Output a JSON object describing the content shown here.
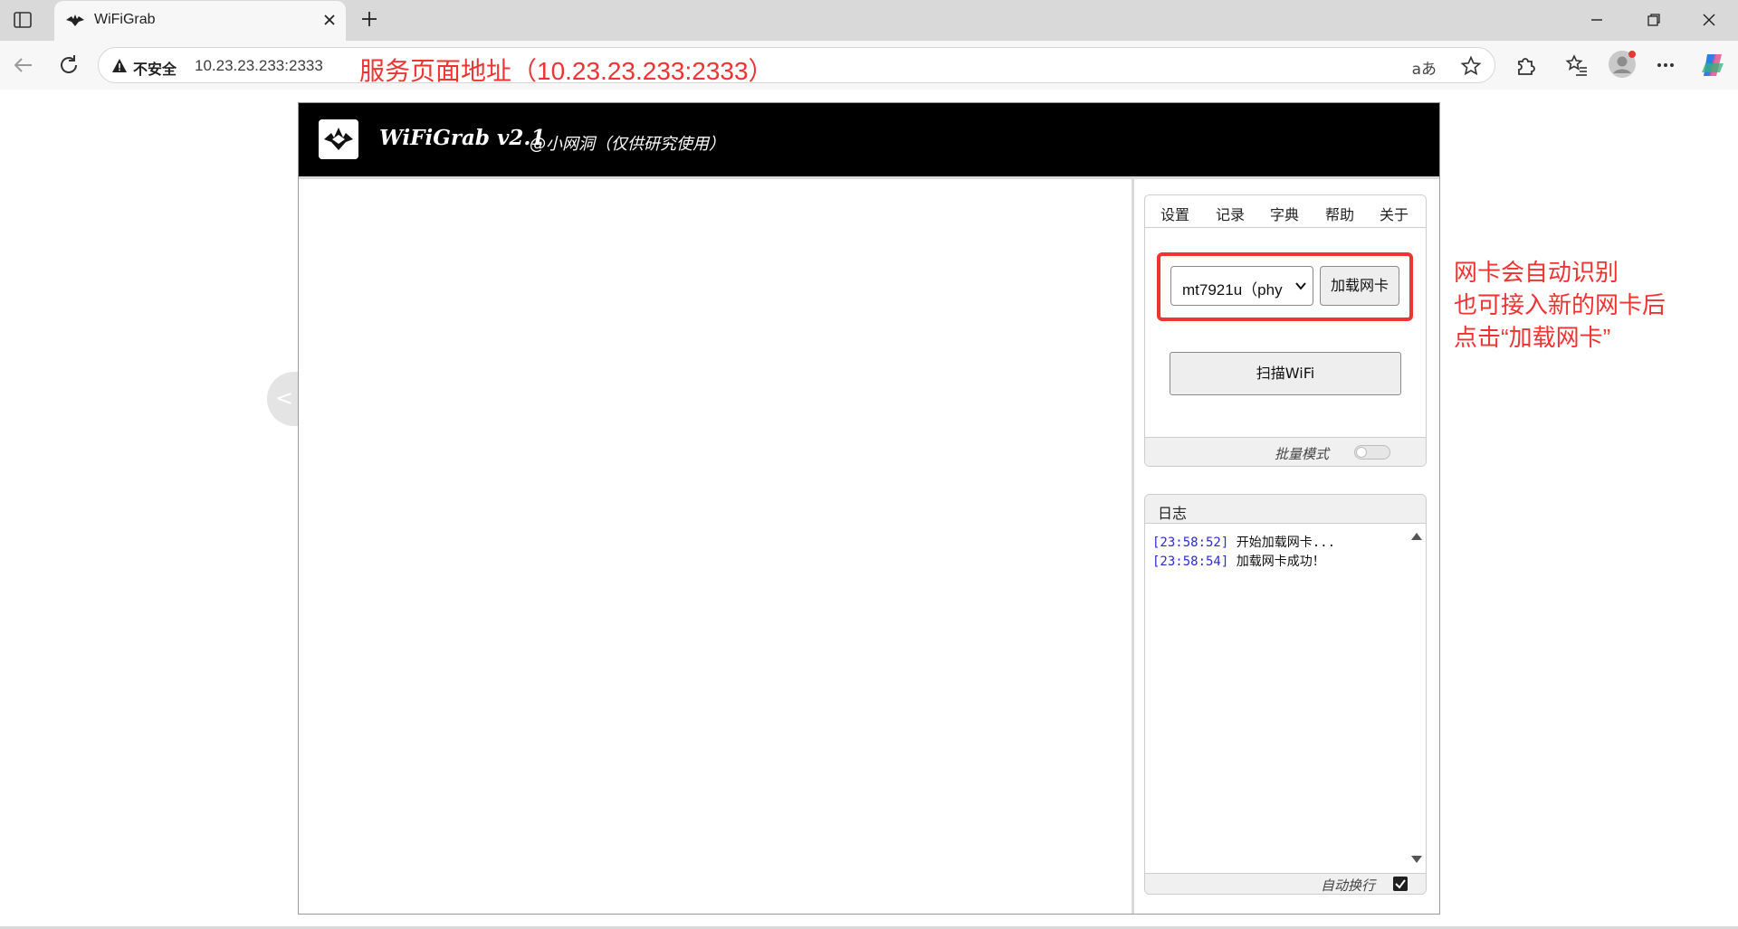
{
  "browser": {
    "tab_title": "WiFiGrab",
    "security_label": "不安全",
    "url": "10.23.23.233:2333",
    "read_aloud_label": "aあ"
  },
  "annotations": {
    "url_note": "服务页面地址（10.23.23.233:2333）",
    "nic_note_lines": [
      "网卡会自动识别",
      "也可接入新的网卡后",
      "点击“加载网卡”"
    ]
  },
  "app": {
    "title": "WiFiGrab v2.1",
    "subtitle": "@小网洞（仅供研究使用）",
    "collapse_label": "<",
    "tabs": [
      "设置",
      "记录",
      "字典",
      "帮助",
      "关于"
    ],
    "nic_select_value": "mt7921u（phy",
    "load_nic_label": "加载网卡",
    "scan_label": "扫描WiFi",
    "batch_mode_label": "批量模式",
    "batch_mode_on": false,
    "log": {
      "title": "日志",
      "entries": [
        {
          "time": "[23:58:52]",
          "message": "开始加载网卡..."
        },
        {
          "time": "[23:58:54]",
          "message": "加载网卡成功！"
        }
      ],
      "auto_wrap_label": "自动换行",
      "auto_wrap_checked": true
    }
  },
  "colors": {
    "annotation": "#ee3333",
    "header_bg": "#000000",
    "log_time": "#2a2ad0"
  },
  "icons": [
    "sidebar-toggle-icon",
    "wifigrab-logo-icon",
    "close-icon",
    "plus-icon",
    "minimize-icon",
    "restore-icon",
    "back-icon",
    "refresh-icon",
    "warning-icon",
    "star-icon",
    "extensions-icon",
    "favorites-icon",
    "profile-icon",
    "more-icon",
    "copilot-icon",
    "chevron-down-icon",
    "checkmark-icon"
  ]
}
